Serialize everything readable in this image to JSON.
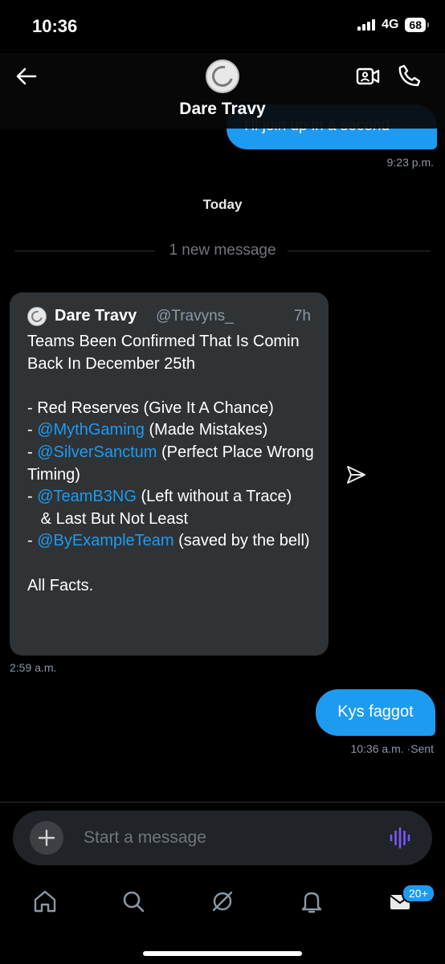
{
  "status_bar": {
    "time": "10:36",
    "network": "4G",
    "battery": "68"
  },
  "header": {
    "contact_name": "Dare Travy"
  },
  "previous_message": {
    "text": "I'll join up in a second",
    "time": "9:23 p.m."
  },
  "day_separator": "Today",
  "new_message_divider": "1 new message",
  "shared_post": {
    "author_name": "Dare Travy",
    "author_handle": "@Travyns_",
    "age": "7h",
    "line1": "Teams Been Confirmed That Is Comin Back In December 25th",
    "line2": "- Red Reserves (Give It A Chance)",
    "mention1": "@MythGaming",
    "mention1_text": " (Made Mistakes)",
    "mention2": "@SilverSanctum",
    "mention2_text": " (Perfect Place Wrong Timing)",
    "mention3": "@TeamB3NG",
    "mention3_text": " (Left without a Trace)",
    "line_last": "   & Last But Not Least",
    "mention4": "@ByExampleTeam",
    "mention4_text": " (saved by the bell)",
    "closing": "All Facts.",
    "time": "2:59 a.m."
  },
  "sent_message": {
    "text": "Kys faggot",
    "time": "10:36 a.m.",
    "status": "Sent"
  },
  "composer": {
    "placeholder": "Start a message"
  },
  "tabs": {
    "messages_badge": "20+"
  },
  "colors": {
    "accent": "#1d9bf0",
    "card": "#2f3336",
    "voice": "#7856ff"
  }
}
